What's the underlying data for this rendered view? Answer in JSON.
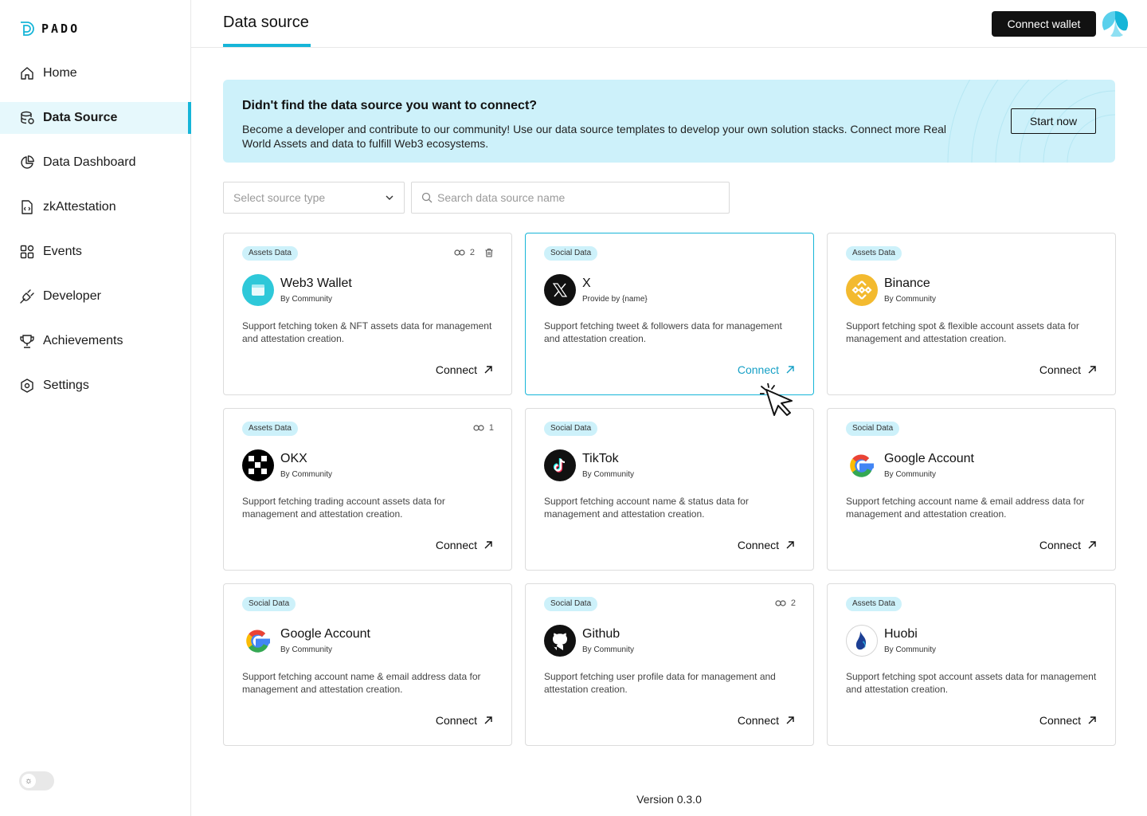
{
  "app": {
    "logo_text": "PADO"
  },
  "sidebar": {
    "items": [
      {
        "label": "Home",
        "icon": "home-icon"
      },
      {
        "label": "Data Source",
        "icon": "database-icon",
        "active": true
      },
      {
        "label": "Data Dashboard",
        "icon": "pie-chart-icon"
      },
      {
        "label": "zkAttestation",
        "icon": "code-file-icon"
      },
      {
        "label": "Events",
        "icon": "grid-icon"
      },
      {
        "label": "Developer",
        "icon": "plug-icon"
      },
      {
        "label": "Achievements",
        "icon": "trophy-icon"
      },
      {
        "label": "Settings",
        "icon": "gear-icon"
      }
    ]
  },
  "header": {
    "title": "Data source",
    "connect_wallet_label": "Connect wallet"
  },
  "banner": {
    "title": "Didn't find the data source you want to connect?",
    "text": "Become a developer and contribute to our community! Use our data source templates to develop your own solution stacks. Connect more Real World Assets and data to fulfill Web3 ecosystems.",
    "button_label": "Start now"
  },
  "filters": {
    "source_type_placeholder": "Select source type",
    "search_placeholder": "Search data source name"
  },
  "cards": [
    {
      "tag": "Assets Data",
      "name": "Web3 Wallet",
      "by": "By Community",
      "desc": "Support fetching token & NFT assets data for management and attestation creation.",
      "connect": "Connect",
      "link_count": "2",
      "logo": "wallet-icon"
    },
    {
      "tag": "Social Data",
      "name": "X",
      "by": "Provide by {name}",
      "desc": "Support fetching tweet & followers data for management and attestation creation.",
      "connect": "Connect",
      "logo": "x-logo-icon"
    },
    {
      "tag": "Assets Data",
      "name": "Binance",
      "by": "By Community",
      "desc": "Support fetching spot & flexible account assets data for management and attestation creation.",
      "connect": "Connect",
      "logo": "binance-logo-icon"
    },
    {
      "tag": "Assets Data",
      "name": "OKX",
      "by": "By Community",
      "desc": "Support fetching trading account assets data for management and attestation creation.",
      "connect": "Connect",
      "link_count": "1",
      "logo": "okx-logo-icon"
    },
    {
      "tag": "Social Data",
      "name": "TikTok",
      "by": "By Community",
      "desc": "Support fetching account name & status data for management and attestation creation.",
      "connect": "Connect",
      "logo": "tiktok-logo-icon"
    },
    {
      "tag": "Social Data",
      "name": "Google Account",
      "by": "By Community",
      "desc": "Support fetching account name & email address data for management and attestation creation.",
      "connect": "Connect",
      "logo": "google-logo-icon"
    },
    {
      "tag": "Social Data",
      "name": "Google Account",
      "by": "By Community",
      "desc": "Support fetching account name & email address data for management and attestation creation.",
      "connect": "Connect",
      "logo": "google-logo-icon"
    },
    {
      "tag": "Social Data",
      "name": "Github",
      "by": "By Community",
      "desc": "Support fetching user profile data for management and attestation creation.",
      "connect": "Connect",
      "link_count": "2",
      "logo": "github-logo-icon"
    },
    {
      "tag": "Assets Data",
      "name": "Huobi",
      "by": "By Community",
      "desc": "Support fetching spot account assets data for management and attestation creation.",
      "connect": "Connect",
      "logo": "huobi-logo-icon"
    }
  ],
  "footer": {
    "version": "Version 0.3.0"
  },
  "colors": {
    "accent": "#16b5d8",
    "tag_bg": "#cdf1fa",
    "banner_bg": "#cdf1fa"
  }
}
